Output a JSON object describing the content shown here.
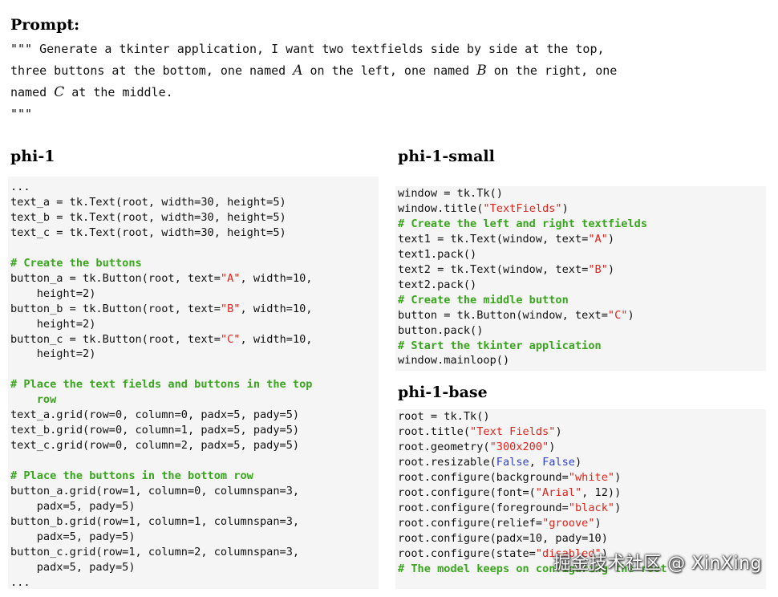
{
  "prompt": {
    "heading": "Prompt:",
    "line1": "\"\"\" Generate a tkinter application, I want two textfields side by side at the top,",
    "line2_a": "three buttons at the bottom, one named ",
    "line2_var_a": "A",
    "line2_b": " on the left, one named ",
    "line2_var_b": "B",
    "line2_c": " on the right, one",
    "line3_a": "named ",
    "line3_var_c": "C",
    "line3_b": " at the middle.",
    "line4": "\"\"\""
  },
  "panels": [
    {
      "heading": "phi-1",
      "lines": [
        [
          {
            "t": "..."
          }
        ],
        [
          {
            "t": "text_a = tk.Text(root, width=30, height=5)"
          }
        ],
        [
          {
            "t": "text_b = tk.Text(root, width=30, height=5)"
          }
        ],
        [
          {
            "t": "text_c = tk.Text(root, width=30, height=5)"
          }
        ],
        [],
        [
          {
            "t": "# Create the buttons",
            "c": "cm"
          }
        ],
        [
          {
            "t": "button_a = tk.Button(root, text="
          },
          {
            "t": "\"A\"",
            "c": "st"
          },
          {
            "t": ", width=10,"
          }
        ],
        [
          {
            "t": "    height=2)"
          }
        ],
        [
          {
            "t": "button_b = tk.Button(root, text="
          },
          {
            "t": "\"B\"",
            "c": "st"
          },
          {
            "t": ", width=10,"
          }
        ],
        [
          {
            "t": "    height=2)"
          }
        ],
        [
          {
            "t": "button_c = tk.Button(root, text="
          },
          {
            "t": "\"C\"",
            "c": "st"
          },
          {
            "t": ", width=10,"
          }
        ],
        [
          {
            "t": "    height=2)"
          }
        ],
        [],
        [
          {
            "t": "# Place the text fields and buttons in the top",
            "c": "cm"
          }
        ],
        [
          {
            "t": "    row",
            "c": "cm"
          }
        ],
        [
          {
            "t": "text_a.grid(row=0, column=0, padx=5, pady=5)"
          }
        ],
        [
          {
            "t": "text_b.grid(row=0, column=1, padx=5, pady=5)"
          }
        ],
        [
          {
            "t": "text_c.grid(row=0, column=2, padx=5, pady=5)"
          }
        ],
        [],
        [
          {
            "t": "# Place the buttons in the bottom row",
            "c": "cm"
          }
        ],
        [
          {
            "t": "button_a.grid(row=1, column=0, columnspan=3,"
          }
        ],
        [
          {
            "t": "    padx=5, pady=5)"
          }
        ],
        [
          {
            "t": "button_b.grid(row=1, column=1, columnspan=3,"
          }
        ],
        [
          {
            "t": "    padx=5, pady=5)"
          }
        ],
        [
          {
            "t": "button_c.grid(row=1, column=2, columnspan=3,"
          }
        ],
        [
          {
            "t": "    padx=5, pady=5)"
          }
        ],
        [
          {
            "t": "..."
          }
        ]
      ]
    },
    {
      "heading": "phi-1-small",
      "lines": [
        [
          {
            "t": "window = tk.Tk()"
          }
        ],
        [
          {
            "t": "window.title("
          },
          {
            "t": "\"TextFields\"",
            "c": "st"
          },
          {
            "t": ")"
          }
        ],
        [
          {
            "t": "# Create the left and right textfields",
            "c": "cm"
          }
        ],
        [
          {
            "t": "text1 = tk.Text(window, text="
          },
          {
            "t": "\"A\"",
            "c": "st"
          },
          {
            "t": ")"
          }
        ],
        [
          {
            "t": "text1.pack()"
          }
        ],
        [
          {
            "t": "text2 = tk.Text(window, text="
          },
          {
            "t": "\"B\"",
            "c": "st"
          },
          {
            "t": ")"
          }
        ],
        [
          {
            "t": "text2.pack()"
          }
        ],
        [
          {
            "t": "# Create the middle button",
            "c": "cm"
          }
        ],
        [
          {
            "t": "button = tk.Button(window, text="
          },
          {
            "t": "\"C\"",
            "c": "st"
          },
          {
            "t": ")"
          }
        ],
        [
          {
            "t": "button.pack()"
          }
        ],
        [
          {
            "t": "# Start the tkinter application",
            "c": "cm"
          }
        ],
        [
          {
            "t": "window.mainloop()"
          }
        ]
      ]
    },
    {
      "heading": "phi-1-base",
      "lines": [
        [
          {
            "t": "root = tk.Tk()"
          }
        ],
        [
          {
            "t": "root.title("
          },
          {
            "t": "\"Text Fields\"",
            "c": "st"
          },
          {
            "t": ")"
          }
        ],
        [
          {
            "t": "root.geometry("
          },
          {
            "t": "\"300x200\"",
            "c": "st"
          },
          {
            "t": ")"
          }
        ],
        [
          {
            "t": "root.resizable("
          },
          {
            "t": "False",
            "c": "kw"
          },
          {
            "t": ", "
          },
          {
            "t": "False",
            "c": "kw"
          },
          {
            "t": ")"
          }
        ],
        [
          {
            "t": "root.configure(background="
          },
          {
            "t": "\"white\"",
            "c": "st"
          },
          {
            "t": ")"
          }
        ],
        [
          {
            "t": "root.configure(font=("
          },
          {
            "t": "\"Arial\"",
            "c": "st"
          },
          {
            "t": ", 12))"
          }
        ],
        [
          {
            "t": "root.configure(foreground="
          },
          {
            "t": "\"black\"",
            "c": "st"
          },
          {
            "t": ")"
          }
        ],
        [
          {
            "t": "root.configure(relief="
          },
          {
            "t": "\"groove\"",
            "c": "st"
          },
          {
            "t": ")"
          }
        ],
        [
          {
            "t": "root.configure(padx=10, pady=10)"
          }
        ],
        [
          {
            "t": "root.configure(state="
          },
          {
            "t": "\"disabled\"",
            "c": "st"
          },
          {
            "t": ")"
          }
        ],
        [
          {
            "t": "# The model keeps on configuring the root",
            "c": "cm"
          }
        ]
      ]
    }
  ],
  "watermark": "掘金技术社区 @ XinXing",
  "colors": {
    "comment": "#3aa51e",
    "string": "#e0241b",
    "keyword": "#2f3fc6",
    "code_background": "#f5f5f5"
  }
}
